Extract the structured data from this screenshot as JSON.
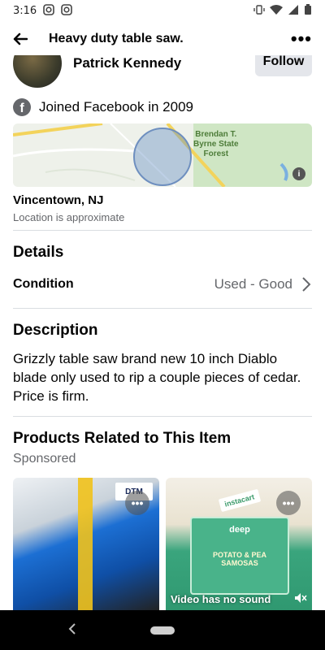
{
  "status": {
    "time": "3:16"
  },
  "app_bar": {
    "title": "Heavy duty table saw.",
    "more": "•••"
  },
  "seller": {
    "name": "Patrick Kennedy",
    "follow_label": "Follow"
  },
  "joined": {
    "fb_glyph": "f",
    "text": "Joined Facebook in 2009"
  },
  "map": {
    "label": "Brendan T.\nByrne State\nForest",
    "info": "i"
  },
  "location": {
    "city": "Vincentown, NJ",
    "note": "Location is approximate"
  },
  "details": {
    "title": "Details",
    "condition_label": "Condition",
    "condition_value": "Used - Good"
  },
  "description": {
    "title": "Description",
    "text": "Grizzly table saw brand new 10 inch Diablo blade only used to rip a couple pieces of cedar. Price is firm."
  },
  "related": {
    "title": "Products Related to This Item",
    "sponsored": "Sponsored",
    "cards": [
      {
        "brand": "DTM",
        "more": "•••"
      },
      {
        "more": "•••",
        "badge": "instacart",
        "pkg_brand": "deep",
        "pkg_text": "POTATO & PEA SAMOSAS",
        "video_note": "Video has no sound"
      }
    ]
  },
  "colors": {
    "follow_bg": "#e4e6eb",
    "secondary_text": "#65676b",
    "divider": "#dadde1"
  }
}
